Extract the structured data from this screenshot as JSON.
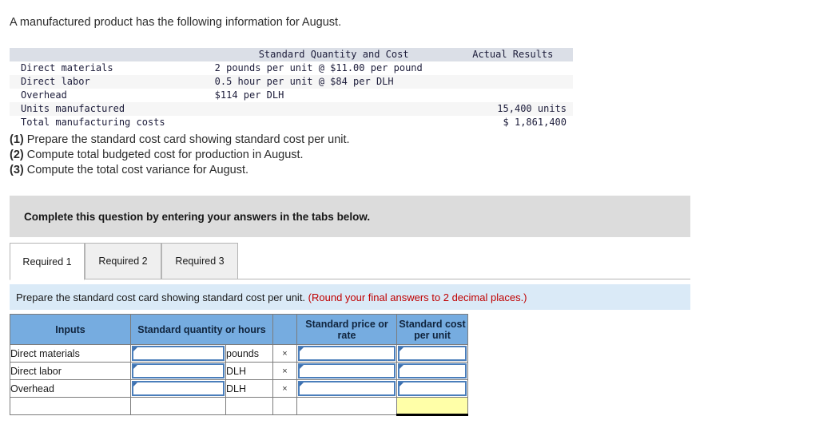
{
  "intro": "A manufactured product has the following information for August.",
  "info_table": {
    "headers": [
      "",
      "Standard Quantity and Cost",
      "Actual Results"
    ],
    "rows": [
      {
        "label": "Direct materials",
        "standard": "2 pounds per unit @ $11.00 per pound",
        "actual": ""
      },
      {
        "label": "Direct labor",
        "standard": "0.5 hour per unit @ $84 per DLH",
        "actual": ""
      },
      {
        "label": "Overhead",
        "standard": "$114 per DLH",
        "actual": ""
      },
      {
        "label": "Units manufactured",
        "standard": "",
        "actual": "15,400 units"
      },
      {
        "label": "Total manufacturing costs",
        "standard": "",
        "actual": "$ 1,861,400"
      }
    ]
  },
  "requirements": [
    {
      "num": "(1)",
      "text": " Prepare the standard cost card showing standard cost per unit."
    },
    {
      "num": "(2)",
      "text": " Compute total budgeted cost for production in August."
    },
    {
      "num": "(3)",
      "text": " Compute the total cost variance for August."
    }
  ],
  "gray_banner": "Complete this question by entering your answers in the tabs below.",
  "tabs": [
    {
      "label": "Required 1",
      "active": true
    },
    {
      "label": "Required 2",
      "active": false
    },
    {
      "label": "Required 3",
      "active": false
    }
  ],
  "blue_strip": {
    "text": "Prepare the standard cost card showing standard cost per unit. ",
    "note": "(Round your final answers to 2 decimal places.)"
  },
  "answer_table": {
    "headers": {
      "inputs": "Inputs",
      "quantity": "Standard quantity or hours",
      "spacer": "",
      "rate": "Standard price or rate",
      "cost": "Standard cost per unit"
    },
    "rows": [
      {
        "label": "Direct materials",
        "qty_value": "",
        "uom": "pounds",
        "operator": "×",
        "rate_value": "",
        "cost_value": ""
      },
      {
        "label": "Direct labor",
        "qty_value": "",
        "uom": "DLH",
        "operator": "×",
        "rate_value": "",
        "cost_value": ""
      },
      {
        "label": "Overhead",
        "qty_value": "",
        "uom": "DLH",
        "operator": "×",
        "rate_value": "",
        "cost_value": ""
      }
    ],
    "total_row": {
      "label": "",
      "qty_value": "",
      "uom": "",
      "operator": "",
      "rate_value": "",
      "total_value": ""
    }
  },
  "colors": {
    "header_blue": "#76ace0",
    "strip_blue": "#daeaf7",
    "banner_gray": "#dcdcdc",
    "note_red": "#c00000",
    "total_yellow": "#ffffa8",
    "input_border": "#4a7ebb"
  }
}
